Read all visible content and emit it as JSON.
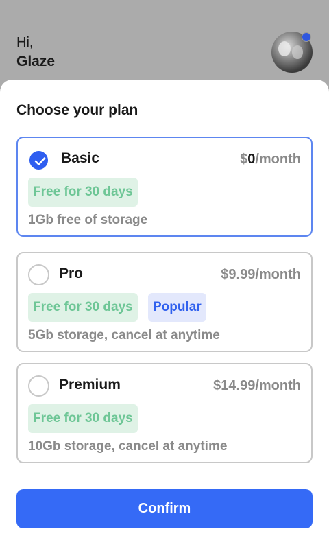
{
  "header": {
    "greeting": "Hi,",
    "user_name": "Glaze",
    "avatar_icon": "avatar-photo",
    "status_color": "#2f57e0"
  },
  "sheet": {
    "title": "Choose your plan"
  },
  "plans": [
    {
      "name": "Basic",
      "price_prefix": "$",
      "price_amount": "0",
      "price_suffix": "/month",
      "badge": "Free for 30 days",
      "description": "1Gb free of storage",
      "selected": true
    },
    {
      "name": "Pro",
      "price": "$9.99/month",
      "badge": "Free for 30 days",
      "extra_badge": "Popular",
      "description": "5Gb storage, cancel at anytime",
      "selected": false
    },
    {
      "name": "Premium",
      "price": "$14.99/month",
      "badge": "Free for 30 days",
      "description": "10Gb storage, cancel at anytime",
      "selected": false
    }
  ],
  "confirm_label": "Confirm",
  "colors": {
    "accent": "#356af6",
    "free_badge_text": "#6ec696",
    "popular_badge_text": "#3161ee"
  }
}
